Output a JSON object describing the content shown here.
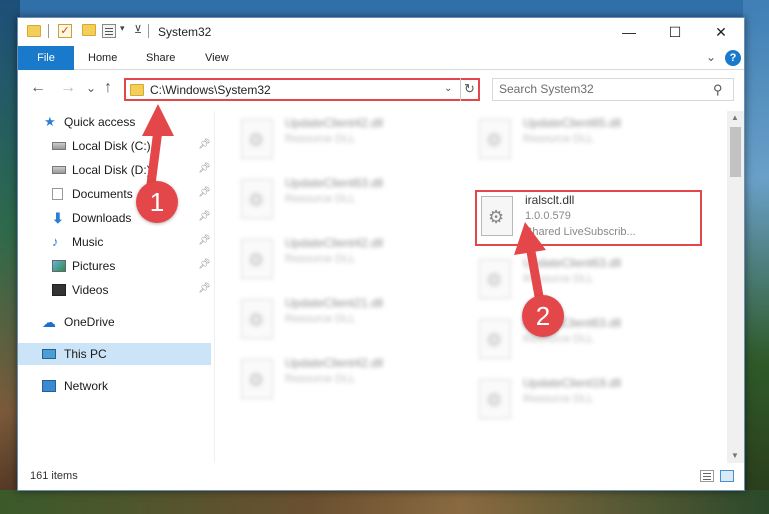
{
  "window": {
    "title": "System32"
  },
  "ribbon": {
    "tabs": [
      "File",
      "Home",
      "Share",
      "View"
    ]
  },
  "address": {
    "path": "C:\\Windows\\System32"
  },
  "search": {
    "placeholder": "Search System32"
  },
  "sidebar": {
    "items": [
      {
        "label": "Quick access",
        "icon": "star-icon"
      },
      {
        "label": "Local Disk (C:)",
        "icon": "disk-icon",
        "pinned": true
      },
      {
        "label": "Local Disk (D:)",
        "icon": "disk-icon",
        "pinned": true
      },
      {
        "label": "Documents",
        "icon": "document-icon",
        "pinned": true
      },
      {
        "label": "Downloads",
        "icon": "download-icon",
        "pinned": true
      },
      {
        "label": "Music",
        "icon": "music-icon",
        "pinned": true
      },
      {
        "label": "Pictures",
        "icon": "pictures-icon",
        "pinned": true
      },
      {
        "label": "Videos",
        "icon": "videos-icon",
        "pinned": true
      },
      {
        "label": "OneDrive",
        "icon": "cloud-icon"
      },
      {
        "label": "This PC",
        "icon": "computer-icon",
        "selected": true
      },
      {
        "label": "Network",
        "icon": "network-icon"
      }
    ]
  },
  "files": {
    "left": [
      {
        "name": "UpdateClient42.dll",
        "type": "Resource DLL"
      },
      {
        "name": "UpdateClient63.dll",
        "type": "Resource DLL"
      },
      {
        "name": "UpdateClient42.dll",
        "type": "Resource DLL"
      },
      {
        "name": "UpdateClient21.dll",
        "type": "Resource DLL"
      },
      {
        "name": "UpdateClient42.dll",
        "type": "Resource DLL"
      }
    ],
    "right": [
      {
        "name": "UpdateClient65.dll",
        "type": "Resource DLL"
      },
      {
        "name": "UpdateClient63.dll",
        "type": "Resource DLL"
      },
      {
        "name": "UpdateClient63.dll",
        "type": "Resource DLL"
      },
      {
        "name": "UpdateClient19.dll",
        "type": "Resource DLL"
      }
    ],
    "highlighted": {
      "name": "iralsclt.dll",
      "version": "1.0.0.579",
      "description": "Shared LiveSubscrib..."
    }
  },
  "status": {
    "item_count": "161 items"
  },
  "annotations": {
    "badge1": "1",
    "badge2": "2",
    "accent_color": "#e3474a"
  },
  "controls": {
    "minimize": "—",
    "maximize": "☐",
    "close": "✕",
    "back": "←",
    "forward": "→",
    "recent": "⌄",
    "up": "↑",
    "ribbon_toggle": "⌄",
    "help": "?",
    "refresh": "↻",
    "search_glyph": "⚲"
  }
}
